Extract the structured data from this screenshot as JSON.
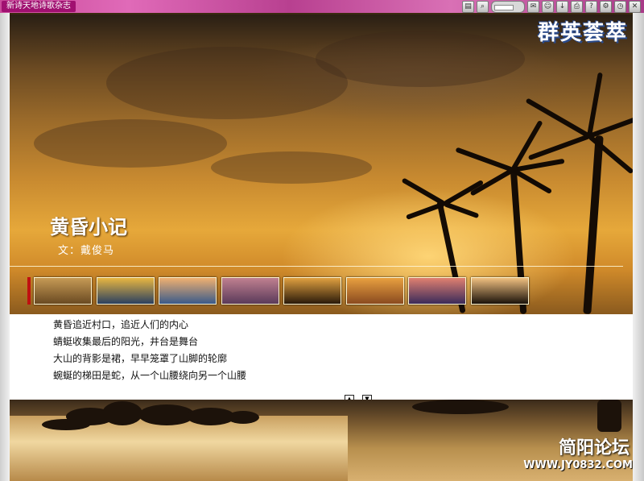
{
  "window": {
    "title": "新诗天地诗歌杂志"
  },
  "toolbar": {
    "icons": [
      "page-icon",
      "search-icon",
      "zoom-slider",
      "comment-icon",
      "user-icon",
      "download-icon",
      "print-icon",
      "help-icon",
      "settings-icon",
      "clock-icon",
      "close-icon"
    ],
    "zoom_label": "60"
  },
  "page": {
    "corner_logo": "群英荟萃",
    "poem_title": "黄昏小记",
    "poem_author": "文：戴俊马",
    "thumbnails": [
      {
        "name": "thumb-1",
        "colors": [
          "#c69a55",
          "#6a4a22"
        ]
      },
      {
        "name": "thumb-2",
        "colors": [
          "#e8b640",
          "#2a4060"
        ]
      },
      {
        "name": "thumb-3",
        "colors": [
          "#f0b070",
          "#3a5a8a"
        ]
      },
      {
        "name": "thumb-4",
        "colors": [
          "#c08090",
          "#5a3a5a"
        ]
      },
      {
        "name": "thumb-5",
        "colors": [
          "#e0a040",
          "#2a1a0a"
        ]
      },
      {
        "name": "thumb-6",
        "colors": [
          "#e8a040",
          "#8a4a20"
        ]
      },
      {
        "name": "thumb-7",
        "colors": [
          "#e08070",
          "#3a2a5a"
        ]
      },
      {
        "name": "thumb-8",
        "colors": [
          "#f0c080",
          "#1a120a"
        ]
      }
    ],
    "poem_lines": [
      "黄昏追近村口，追近人们的内心",
      "蜻蜓收集最后的阳光，井台是舞台",
      "大山的背影是裙，早早笼罩了山脚的轮廓",
      "蜿蜒的梯田是蛇，从一个山腰绕向另一个山腰"
    ],
    "scroll_up": "▲",
    "scroll_down": "▼",
    "forum_logo": "简阳论坛",
    "forum_url": "WWW.JY0832.COM"
  }
}
